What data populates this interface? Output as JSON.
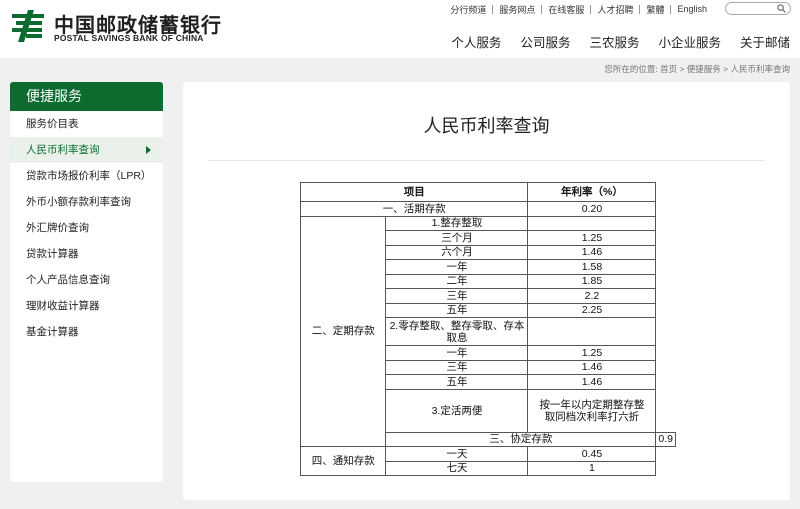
{
  "logo": {
    "name_cn": "中国邮政储蓄银行",
    "name_en": "POSTAL SAVINGS BANK OF CHINA"
  },
  "top_links": [
    "分行频道",
    "服务网点",
    "在线客服",
    "人才招聘",
    "繁體",
    "English"
  ],
  "search": {
    "placeholder": ""
  },
  "main_nav": [
    "个人服务",
    "公司服务",
    "三农服务",
    "小企业服务",
    "关于邮储"
  ],
  "breadcrumb": "您所在的位置:  首页 > 便捷服务 > 人民币利率查询",
  "sidebar": {
    "title": "便捷服务",
    "items": [
      {
        "label": "服务价目表",
        "active": false
      },
      {
        "label": "人民币利率查询",
        "active": true
      },
      {
        "label": "贷款市场报价利率（LPR）",
        "active": false
      },
      {
        "label": "外币小额存款利率查询",
        "active": false
      },
      {
        "label": "外汇牌价查询",
        "active": false
      },
      {
        "label": "贷款计算器",
        "active": false
      },
      {
        "label": "个人产品信息查询",
        "active": false
      },
      {
        "label": "理财收益计算器",
        "active": false
      },
      {
        "label": "基金计算器",
        "active": false
      }
    ]
  },
  "page_title": "人民币利率查询",
  "table": {
    "header_item": "项目",
    "header_rate": "年利率（%）",
    "current": {
      "label": "一、活期存款",
      "rate": "0.20"
    },
    "fixed": {
      "label": "二、定期存款",
      "sub1": "1.整存整取",
      "sub1_rows": [
        {
          "term": "三个月",
          "rate": "1.25"
        },
        {
          "term": "六个月",
          "rate": "1.46"
        },
        {
          "term": "一年",
          "rate": "1.58"
        },
        {
          "term": "二年",
          "rate": "1.85"
        },
        {
          "term": "三年",
          "rate": "2.2"
        },
        {
          "term": "五年",
          "rate": "2.25"
        }
      ],
      "sub2": "2.零存整取、整存零取、存本取息",
      "sub2_rows": [
        {
          "term": "一年",
          "rate": "1.25"
        },
        {
          "term": "三年",
          "rate": "1.46"
        },
        {
          "term": "五年",
          "rate": "1.46"
        }
      ],
      "sub3": "3.定活两便",
      "sub3_rate": "按一年以内定期整存整取同档次利率打六折"
    },
    "agreement": {
      "label": "三、协定存款",
      "rate": "0.9"
    },
    "notice": {
      "label": "四、通知存款",
      "rows": [
        {
          "term": "一天",
          "rate": "0.45"
        },
        {
          "term": "七天",
          "rate": "1"
        }
      ]
    }
  }
}
